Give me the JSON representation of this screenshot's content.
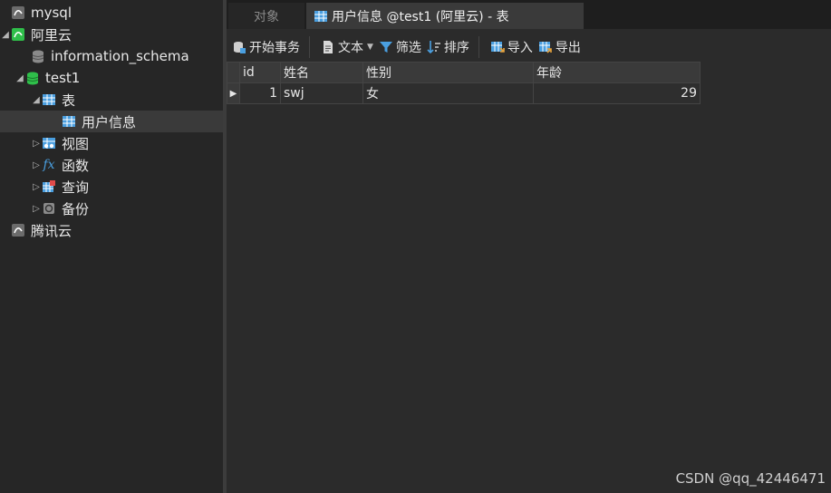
{
  "sidebar": {
    "items": [
      {
        "label": "mysql",
        "icon": "mysql-connection-icon"
      },
      {
        "label": "阿里云",
        "icon": "mysql-connection-active-icon"
      },
      {
        "label": "information_schema",
        "icon": "database-icon"
      },
      {
        "label": "test1",
        "icon": "database-active-icon"
      },
      {
        "label": "表",
        "icon": "tables-folder-icon"
      },
      {
        "label": "用户信息",
        "icon": "table-icon"
      },
      {
        "label": "视图",
        "icon": "view-icon"
      },
      {
        "label": "函数",
        "icon": "function-icon"
      },
      {
        "label": "查询",
        "icon": "query-icon"
      },
      {
        "label": "备份",
        "icon": "backup-icon"
      },
      {
        "label": "腾讯云",
        "icon": "mysql-connection-icon"
      }
    ]
  },
  "tabs": {
    "objects": "对象",
    "active": "用户信息 @test1 (阿里云) - 表"
  },
  "toolbar": {
    "begin_transaction": "开始事务",
    "text": "文本",
    "filter": "筛选",
    "sort": "排序",
    "import": "导入",
    "export": "导出"
  },
  "table": {
    "columns": [
      "id",
      "姓名",
      "性别",
      "年龄"
    ],
    "rows": [
      [
        "1",
        "swj",
        "女",
        "29"
      ]
    ]
  },
  "watermark": "CSDN @qq_42446471",
  "colors": {
    "accent_green": "#2fbf4a",
    "table_icon_blue": "#4a9fe0"
  }
}
